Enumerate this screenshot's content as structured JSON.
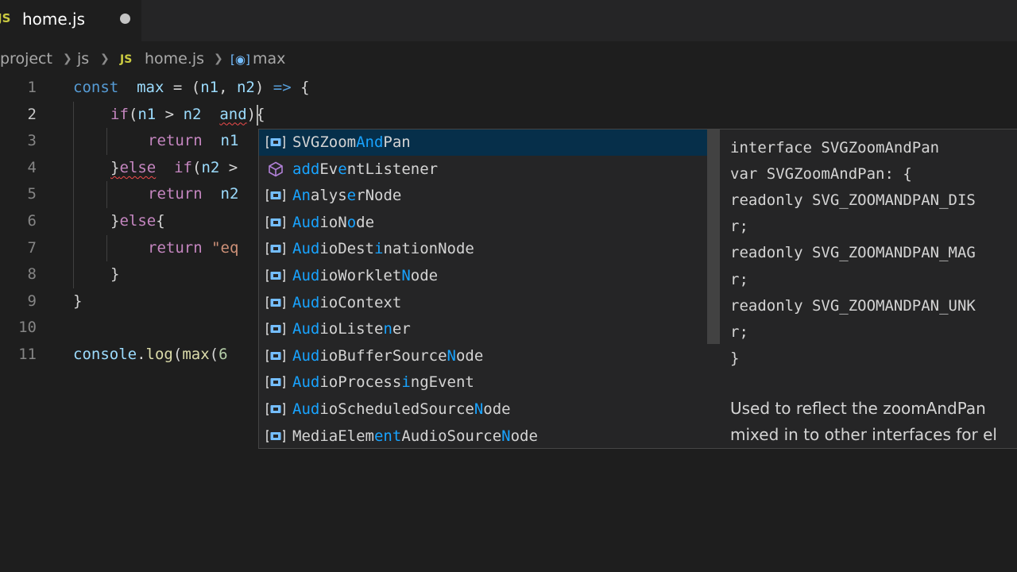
{
  "tab": {
    "badge": "JS",
    "filename": "home.js"
  },
  "breadcrumb": {
    "items": [
      "project",
      "js",
      "JS",
      "home.js",
      "max"
    ]
  },
  "editor": {
    "line_numbers": [
      "1",
      "2",
      "3",
      "4",
      "5",
      "6",
      "7",
      "8",
      "9",
      "10",
      "11"
    ],
    "active_line": 2,
    "lines": [
      {
        "tokens": [
          [
            "kw",
            "const"
          ],
          [
            "",
            "  "
          ],
          [
            "var",
            "max"
          ],
          [
            "",
            " = ("
          ],
          [
            "var",
            "n1"
          ],
          [
            "",
            ", "
          ],
          [
            "var",
            "n2"
          ],
          [
            "",
            ") "
          ],
          [
            "kw",
            "=>"
          ],
          [
            "",
            " {"
          ]
        ]
      },
      {
        "tokens": [
          [
            "ctl",
            "if"
          ],
          [
            "",
            "("
          ],
          [
            "var",
            "n1"
          ],
          [
            "",
            " > "
          ],
          [
            "var",
            "n2"
          ],
          [
            "",
            "  "
          ],
          [
            "var squig",
            "and"
          ],
          [
            "",
            ")"
          ],
          [
            "",
            "{"
          ]
        ]
      },
      {
        "tokens": [
          [
            "ctl",
            "return"
          ],
          [
            "",
            "  "
          ],
          [
            "var",
            "n1"
          ]
        ]
      },
      {
        "tokens": [
          [
            "squig",
            "}"
          ],
          [
            "ctl squig",
            "else"
          ],
          [
            "",
            "  "
          ],
          [
            "ctl",
            "if"
          ],
          [
            "",
            "("
          ],
          [
            "var",
            "n2"
          ],
          [
            "",
            " >"
          ]
        ]
      },
      {
        "tokens": [
          [
            "ctl",
            "return"
          ],
          [
            "",
            "  "
          ],
          [
            "var",
            "n2"
          ]
        ]
      },
      {
        "tokens": [
          [
            "",
            "}"
          ],
          [
            "ctl",
            "else"
          ],
          [
            "",
            "{"
          ]
        ]
      },
      {
        "tokens": [
          [
            "ctl",
            "return"
          ],
          [
            "",
            " "
          ],
          [
            "str",
            "\"eq"
          ]
        ]
      },
      {
        "tokens": [
          [
            "",
            "}"
          ]
        ]
      },
      {
        "tokens": [
          [
            "",
            "}"
          ]
        ]
      },
      {
        "tokens": []
      },
      {
        "tokens": [
          [
            "var",
            "console"
          ],
          [
            "",
            "."
          ],
          [
            "fn",
            "log"
          ],
          [
            "",
            "("
          ],
          [
            "fn",
            "max"
          ],
          [
            "",
            "("
          ],
          [
            "num",
            "6"
          ]
        ]
      }
    ]
  },
  "suggest": {
    "items": [
      {
        "kind": "interface",
        "pre": "SVGZoom",
        "match": "And",
        "post": "Pan",
        "selected": true
      },
      {
        "kind": "method",
        "label": "addEventListener",
        "matchIdx": [
          0,
          1,
          2,
          5
        ]
      },
      {
        "kind": "interface",
        "label": "AnalyserNode",
        "matchIdx": [
          0,
          1,
          6
        ]
      },
      {
        "kind": "interface",
        "label": "AudioNode",
        "matchIdx": [
          0,
          1,
          2,
          6
        ]
      },
      {
        "kind": "interface",
        "label": "AudioDestinationNode",
        "matchIdx": [
          0,
          1,
          2,
          9
        ]
      },
      {
        "kind": "interface",
        "label": "AudioWorkletNode",
        "matchIdx": [
          0,
          1,
          2,
          12
        ]
      },
      {
        "kind": "interface",
        "label": "AudioContext",
        "matchIdx": [
          0,
          1,
          2
        ]
      },
      {
        "kind": "interface",
        "label": "AudioListener",
        "matchIdx": [
          0,
          1,
          2,
          10
        ]
      },
      {
        "kind": "interface",
        "label": "AudioBufferSourceNode",
        "matchIdx": [
          0,
          1,
          2,
          17
        ]
      },
      {
        "kind": "interface",
        "label": "AudioProcessingEvent",
        "matchIdx": [
          0,
          1,
          2,
          12
        ]
      },
      {
        "kind": "interface",
        "label": "AudioScheduledSourceNode",
        "matchIdx": [
          0,
          1,
          2,
          20
        ]
      },
      {
        "kind": "interface",
        "label": "MediaElementAudioSourceNode",
        "matchIdx": [
          9,
          10,
          11,
          23
        ]
      }
    ]
  },
  "details": {
    "signature": [
      "interface SVGZoomAndPan",
      "var SVGZoomAndPan: {",
      "readonly SVG_ZOOMANDPAN_DIS",
      "r;",
      "readonly SVG_ZOOMANDPAN_MAG",
      "r;",
      "readonly SVG_ZOOMANDPAN_UNK",
      "r;",
      "}"
    ],
    "doc": [
      "Used to reflect the zoomAndPan",
      "mixed in to other interfaces for el"
    ]
  },
  "colors": {
    "accent": "#18a3ff",
    "selection": "#062f4a",
    "error": "#f14c4c"
  }
}
